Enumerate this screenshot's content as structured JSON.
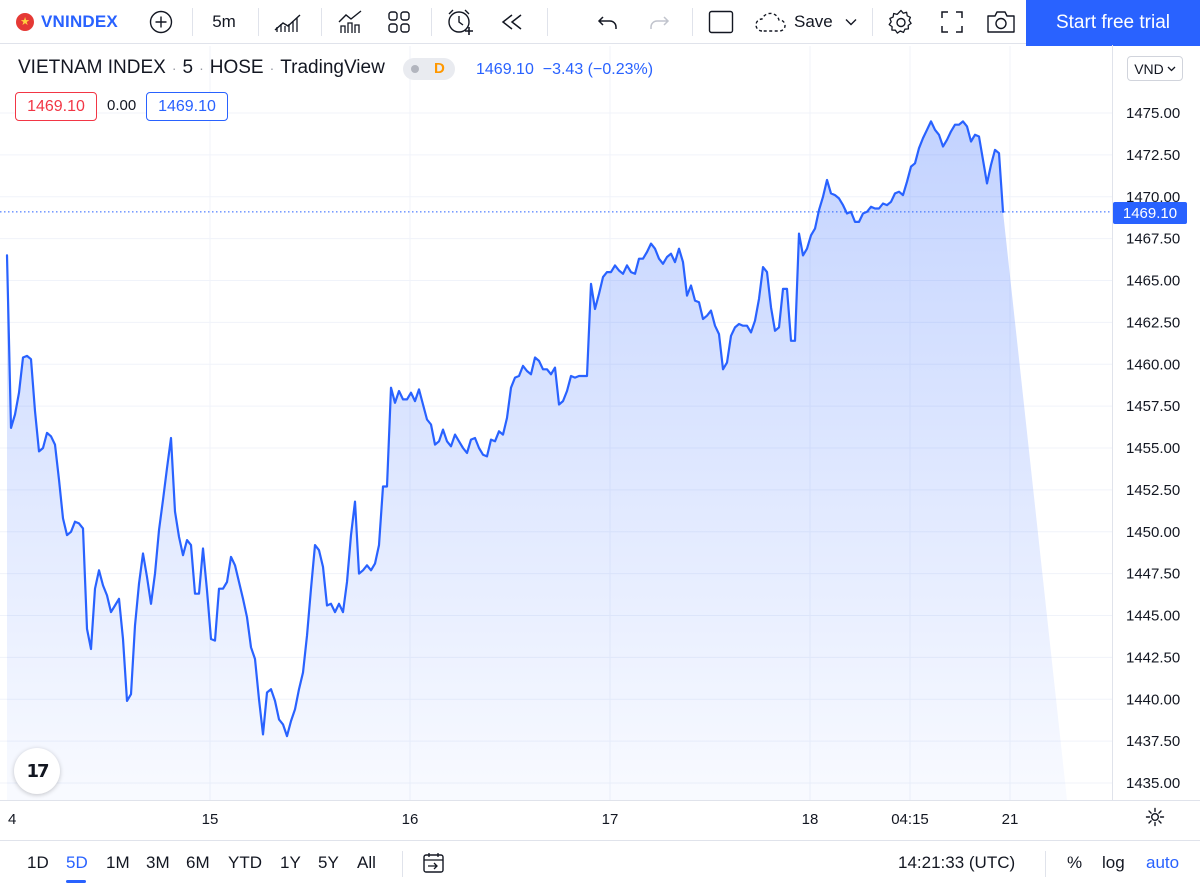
{
  "toolbar": {
    "symbol": "VNINDEX",
    "interval": "5m",
    "save_label": "Save",
    "cta_label": "Start free trial",
    "icons": [
      "vietnam-flag-icon",
      "add-symbol-icon",
      "bar-style-icon",
      "indicators-icon",
      "templates-icon",
      "alert-icon",
      "replay-icon",
      "undo-icon",
      "redo-icon",
      "layout-icon",
      "cloud-save-icon",
      "chevron-down-icon",
      "settings-icon",
      "fullscreen-icon",
      "camera-icon"
    ]
  },
  "legend": {
    "name": "VIETNAM INDEX",
    "interval": "5",
    "exchange": "HOSE",
    "source": "TradingView",
    "badge": "D",
    "last": "1469.10",
    "change": "−3.43",
    "change_pct": "(−0.23%)",
    "bid": "1469.10",
    "spread": "0.00",
    "ask": "1469.10"
  },
  "price_axis": {
    "currency": "VND",
    "last_price_label": "1469.10",
    "ticks": [
      "1475.00",
      "1472.50",
      "1470.00",
      "1467.50",
      "1465.00",
      "1462.50",
      "1460.00",
      "1457.50",
      "1455.00",
      "1452.50",
      "1450.00",
      "1447.50",
      "1445.00",
      "1442.50",
      "1440.00",
      "1437.50",
      "1435.00"
    ]
  },
  "time_axis": {
    "ticks": [
      "4",
      "15",
      "16",
      "17",
      "18",
      "04:15",
      "21"
    ]
  },
  "chart_data": {
    "type": "area",
    "title": "",
    "xlabel": "",
    "ylabel": "",
    "ylim": [
      1434.5,
      1477.5
    ],
    "grid": true,
    "color": "#2962ff",
    "fill_color": "#2962ff",
    "last_value": 1469.1,
    "x": [
      0,
      1,
      2,
      3,
      4,
      5,
      6,
      7,
      8,
      9,
      10,
      11,
      12,
      13,
      14,
      15,
      16,
      17,
      18,
      19,
      20,
      21,
      22,
      23,
      24,
      25,
      26,
      27,
      28,
      29,
      30,
      31,
      32,
      33,
      34,
      35,
      36,
      37,
      38,
      39,
      40,
      41,
      42,
      43,
      44,
      45,
      46,
      47,
      48,
      49,
      50,
      51,
      52,
      53,
      54,
      55,
      56,
      57,
      58,
      59,
      60,
      61,
      62,
      63,
      64,
      65,
      66,
      67,
      68,
      69,
      70,
      71,
      72,
      73,
      74,
      75,
      76,
      77,
      78,
      79,
      80,
      81,
      82,
      83,
      84,
      85,
      86,
      87,
      88,
      89,
      90,
      91,
      92,
      93,
      94,
      95,
      96,
      97,
      98,
      99,
      100,
      101,
      102,
      103,
      104,
      105,
      106,
      107,
      108,
      109,
      110,
      111,
      112,
      113,
      114,
      115,
      116,
      117,
      118,
      119,
      120,
      121,
      122,
      123,
      124,
      125,
      126,
      127,
      128,
      129,
      130,
      131,
      132,
      133,
      134,
      135,
      136,
      137,
      138,
      139,
      140,
      141,
      142,
      143,
      144,
      145,
      146,
      147,
      148,
      149,
      150,
      151,
      152,
      153,
      154,
      155,
      156,
      157,
      158,
      159,
      160,
      161,
      162,
      163,
      164,
      165,
      166,
      167,
      168,
      169,
      170,
      171,
      172,
      173,
      174,
      175,
      176,
      177,
      178,
      179,
      180,
      181,
      182,
      183,
      184,
      185,
      186,
      187,
      188,
      189,
      190,
      191,
      192,
      193,
      194,
      195,
      196,
      197,
      198,
      199,
      200,
      201,
      202,
      203,
      204,
      205,
      206,
      207,
      208,
      209,
      210,
      211,
      212,
      213,
      214,
      215,
      216,
      217,
      218,
      219,
      220,
      221,
      222,
      223,
      224,
      225,
      226,
      227,
      228,
      229,
      230,
      231,
      232,
      233,
      234,
      235,
      236,
      237,
      238,
      239,
      240,
      241,
      242,
      243,
      244,
      245,
      246,
      247,
      248,
      249,
      250,
      251,
      252,
      253,
      254,
      255,
      256,
      257,
      258,
      259,
      260,
      261,
      262,
      263,
      264,
      265
    ],
    "values": [
      1466.5,
      1456.2,
      1457.0,
      1458.3,
      1460.4,
      1460.5,
      1460.3,
      1457.2,
      1454.8,
      1455.0,
      1455.9,
      1455.7,
      1455.2,
      1453.1,
      1450.8,
      1449.8,
      1450.0,
      1450.6,
      1450.5,
      1450.2,
      1444.2,
      1443.0,
      1446.6,
      1447.7,
      1446.8,
      1446.2,
      1445.2,
      1445.6,
      1446.0,
      1443.6,
      1439.9,
      1440.3,
      1444.4,
      1446.9,
      1448.7,
      1447.3,
      1445.7,
      1447.5,
      1450.1,
      1451.9,
      1453.8,
      1455.6,
      1451.2,
      1449.7,
      1448.6,
      1449.5,
      1449.2,
      1446.3,
      1446.3,
      1449.0,
      1446.5,
      1443.6,
      1443.5,
      1446.6,
      1446.6,
      1447.0,
      1448.5,
      1448.0,
      1447.0,
      1446.0,
      1444.9,
      1443.1,
      1442.4,
      1440.0,
      1437.9,
      1440.4,
      1440.6,
      1439.9,
      1438.8,
      1438.5,
      1437.8,
      1438.7,
      1439.4,
      1440.6,
      1441.6,
      1443.8,
      1446.6,
      1449.2,
      1448.9,
      1447.9,
      1445.6,
      1445.7,
      1445.2,
      1445.7,
      1445.2,
      1447.0,
      1449.8,
      1451.8,
      1447.5,
      1447.7,
      1448.0,
      1447.7,
      1448.1,
      1449.2,
      1452.7,
      1452.7,
      1458.6,
      1457.7,
      1458.4,
      1457.9,
      1457.9,
      1458.3,
      1457.8,
      1458.5,
      1457.6,
      1456.7,
      1456.4,
      1455.2,
      1455.4,
      1456.1,
      1455.4,
      1455.1,
      1455.8,
      1455.4,
      1455.0,
      1454.7,
      1455.5,
      1455.6,
      1455.0,
      1454.6,
      1454.5,
      1455.5,
      1455.4,
      1456.0,
      1455.8,
      1456.8,
      1458.6,
      1459.2,
      1459.3,
      1459.9,
      1459.6,
      1459.4,
      1460.4,
      1460.2,
      1459.7,
      1459.7,
      1459.4,
      1459.8,
      1457.6,
      1457.8,
      1458.4,
      1459.3,
      1459.2,
      1459.3,
      1459.3,
      1459.3,
      1464.8,
      1463.3,
      1464.2,
      1465.2,
      1465.5,
      1465.5,
      1465.9,
      1465.6,
      1465.4,
      1465.9,
      1465.5,
      1465.4,
      1466.3,
      1466.3,
      1466.7,
      1467.2,
      1466.9,
      1466.3,
      1466.0,
      1466.4,
      1466.6,
      1466.1,
      1466.9,
      1466.1,
      1464.1,
      1464.7,
      1463.8,
      1463.7,
      1462.7,
      1462.9,
      1463.2,
      1462.3,
      1461.8,
      1459.7,
      1460.1,
      1461.7,
      1462.2,
      1462.4,
      1462.3,
      1462.3,
      1461.9,
      1462.6,
      1463.9,
      1465.8,
      1465.5,
      1463.4,
      1462.0,
      1462.2,
      1464.5,
      1464.5,
      1461.4,
      1461.4,
      1467.8,
      1466.5,
      1466.9,
      1467.7,
      1468.1,
      1469.2,
      1470.0,
      1471.0,
      1470.2,
      1470.1,
      1469.9,
      1469.5,
      1469.0,
      1469.1,
      1468.5,
      1468.5,
      1469.0,
      1469.1,
      1469.4,
      1469.3,
      1469.3,
      1469.6,
      1469.5,
      1469.7,
      1470.2,
      1470.3,
      1470.1,
      1470.9,
      1471.8,
      1472.0,
      1472.9,
      1473.5,
      1474.0,
      1474.5,
      1474.0,
      1473.7,
      1473.0,
      1473.4,
      1473.9,
      1474.3,
      1474.3,
      1474.5,
      1474.2,
      1473.3,
      1473.7,
      1473.6,
      1472.2,
      1470.8,
      1471.9,
      1472.8,
      1472.6,
      1469.1
    ],
    "x_ticks": [
      {
        "label": "4",
        "at": 0
      },
      {
        "label": "15",
        "at": 50
      },
      {
        "label": "16",
        "at": 100
      },
      {
        "label": "17",
        "at": 150
      },
      {
        "label": "18",
        "at": 200
      },
      {
        "label": "04:15",
        "at": 225
      },
      {
        "label": "21",
        "at": 250
      }
    ],
    "y_ticks": [
      1475.0,
      1472.5,
      1470.0,
      1467.5,
      1465.0,
      1462.5,
      1460.0,
      1457.5,
      1455.0,
      1452.5,
      1450.0,
      1447.5,
      1445.0,
      1442.5,
      1440.0,
      1437.5,
      1435.0
    ]
  },
  "bottom": {
    "ranges": [
      "1D",
      "5D",
      "1M",
      "3M",
      "6M",
      "YTD",
      "1Y",
      "5Y",
      "All"
    ],
    "active_range": "5D",
    "clock": "14:21:33 (UTC)",
    "percent_label": "%",
    "log_label": "log",
    "auto_label": "auto"
  }
}
